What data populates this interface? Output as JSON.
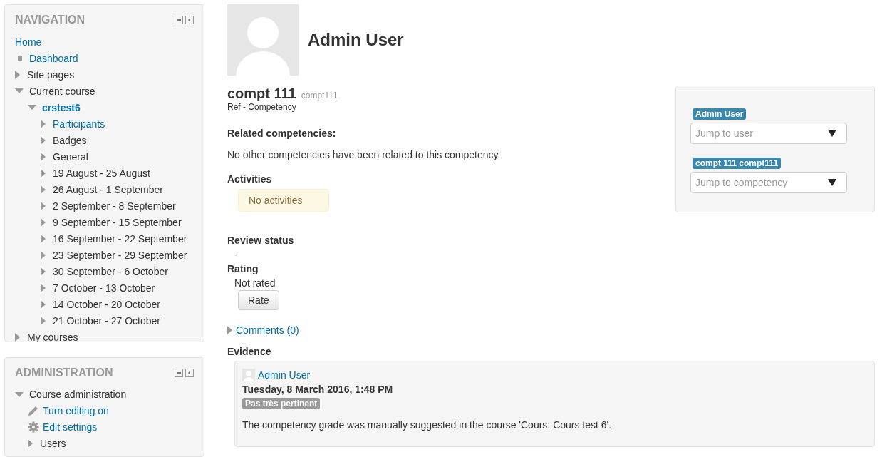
{
  "navigation": {
    "title": "NAVIGATION",
    "items": [
      {
        "label": "Home",
        "kind": "root",
        "link": true
      },
      {
        "label": "Dashboard",
        "kind": "leaf",
        "link": true
      },
      {
        "label": "Site pages",
        "kind": "branch",
        "link": false,
        "expanded": false
      },
      {
        "label": "Current course",
        "kind": "branch",
        "link": false,
        "expanded": true,
        "children": [
          {
            "label": "crstest6",
            "kind": "branch",
            "link": true,
            "bold": true,
            "expanded": true,
            "children": [
              {
                "label": "Participants",
                "kind": "branch",
                "link": true,
                "expanded": false
              },
              {
                "label": "Badges",
                "kind": "branch",
                "link": false,
                "expanded": false
              },
              {
                "label": "General",
                "kind": "branch",
                "link": false,
                "expanded": false
              },
              {
                "label": "19 August - 25 August",
                "kind": "branch",
                "link": false,
                "expanded": false
              },
              {
                "label": "26 August - 1 September",
                "kind": "branch",
                "link": false,
                "expanded": false
              },
              {
                "label": "2 September - 8 September",
                "kind": "branch",
                "link": false,
                "expanded": false
              },
              {
                "label": "9 September - 15 September",
                "kind": "branch",
                "link": false,
                "expanded": false
              },
              {
                "label": "16 September - 22 September",
                "kind": "branch",
                "link": false,
                "expanded": false
              },
              {
                "label": "23 September - 29 September",
                "kind": "branch",
                "link": false,
                "expanded": false
              },
              {
                "label": "30 September - 6 October",
                "kind": "branch",
                "link": false,
                "expanded": false
              },
              {
                "label": "7 October - 13 October",
                "kind": "branch",
                "link": false,
                "expanded": false
              },
              {
                "label": "14 October - 20 October",
                "kind": "branch",
                "link": false,
                "expanded": false
              },
              {
                "label": "21 October - 27 October",
                "kind": "branch",
                "link": false,
                "expanded": false
              }
            ]
          }
        ]
      },
      {
        "label": "My courses",
        "kind": "branch",
        "link": false,
        "expanded": false
      }
    ]
  },
  "administration": {
    "title": "ADMINISTRATION",
    "items": [
      {
        "label": "Course administration",
        "kind": "branch",
        "link": false,
        "expanded": true,
        "children": [
          {
            "label": "Turn editing on",
            "kind": "edit",
            "link": true
          },
          {
            "label": "Edit settings",
            "kind": "settings",
            "link": true
          },
          {
            "label": "Users",
            "kind": "branch",
            "link": false,
            "expanded": false
          }
        ]
      }
    ]
  },
  "user": {
    "name": "Admin User"
  },
  "competency": {
    "name": "compt 111",
    "idnumber": "compt111",
    "framework": "Ref - Competency"
  },
  "related": {
    "heading": "Related competencies:",
    "text": "No other competencies have been related to this competency."
  },
  "activities": {
    "heading": "Activities",
    "notice": "No activities"
  },
  "review": {
    "heading": "Review status",
    "value": "-"
  },
  "rating": {
    "heading": "Rating",
    "value": "Not rated",
    "button": "Rate"
  },
  "comments": {
    "label": "Comments (0)",
    "expanded": false
  },
  "evidence": {
    "heading": "Evidence",
    "items": [
      {
        "user": "Admin User",
        "date": "Tuesday, 8 March 2016, 1:48 PM",
        "grade": "Pas très pertinent",
        "text": "The competency grade was manually suggested in the course 'Cours: Cours test 6'."
      }
    ]
  },
  "navigator": {
    "user_tag": "Admin User",
    "user_placeholder": "Jump to user",
    "competency_tag": "compt 111 compt111",
    "competency_placeholder": "Jump to competency"
  }
}
